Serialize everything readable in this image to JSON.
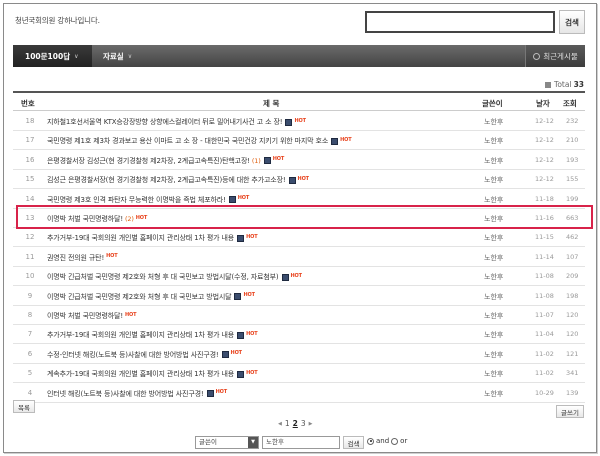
{
  "header": {
    "greeting": "청년국회의원 강하나입니다.",
    "search_button": "검색",
    "search_value": ""
  },
  "nav": {
    "tab1": "100문100답",
    "tab2": "자료실",
    "recent": "최근게시물"
  },
  "list": {
    "total_label": "Total",
    "total_count": "33",
    "columns": {
      "no": "번호",
      "title": "제 목",
      "author": "글쓴이",
      "date": "날자",
      "views": "조회"
    },
    "rows": [
      {
        "no": "18",
        "title": "지하철1호선서울역 KTX승강장방향 상향에스컬레이터 뒤로 밀어내기사건 고 소 장!",
        "comments": "",
        "file": true,
        "hot": true,
        "author": "노한후",
        "date": "12-12",
        "views": "232"
      },
      {
        "no": "17",
        "title": "국민명령 제1호 제3차 경과보고 용산 이마트 고 소 장 - 대한민국 국민건강 지키기 위한 마지막 호소",
        "comments": "",
        "file": true,
        "hot": true,
        "author": "노한후",
        "date": "12-12",
        "views": "210"
      },
      {
        "no": "16",
        "title": "은평경찰서장 김성근(현 경기경찰청 제2차장, 2계급고속특진)탄핵고장!",
        "comments": "(1)",
        "file": true,
        "hot": true,
        "author": "노한후",
        "date": "12-12",
        "views": "193"
      },
      {
        "no": "15",
        "title": "김성근 은평경찰서장(현 경기경찰청 제2차장, 2계급고속특진)등에 대한 추가고소장!",
        "comments": "",
        "file": true,
        "hot": true,
        "author": "노한후",
        "date": "12-12",
        "views": "155"
      },
      {
        "no": "14",
        "title": "국민명령 제3호 인격 파탄자 무능력한 이명박을 즉법 체포하라!",
        "comments": "",
        "file": true,
        "hot": true,
        "author": "노한후",
        "date": "11-18",
        "views": "199"
      },
      {
        "no": "13",
        "title": "이명박 처벌 국민명령하달!",
        "comments": "(2)",
        "file": false,
        "hot": true,
        "author": "노한후",
        "date": "11-16",
        "views": "663"
      },
      {
        "no": "12",
        "title": "추가거부-19대 국회의원 개인별 홈페이지 관리상태 1차 평가 내용",
        "comments": "",
        "file": true,
        "hot": true,
        "author": "노한후",
        "date": "11-15",
        "views": "462"
      },
      {
        "no": "11",
        "title": "권영진 전의원 규탄!",
        "comments": "",
        "file": false,
        "hot": true,
        "author": "노한후",
        "date": "11-14",
        "views": "107"
      },
      {
        "no": "10",
        "title": "이명박 긴급처벌 국민명령 제2호와 처형 후 대 국민보고 방법시달(수정, 자료첨부)",
        "comments": "",
        "file": true,
        "hot": true,
        "author": "노한후",
        "date": "11-08",
        "views": "209"
      },
      {
        "no": "9",
        "title": "이명박 긴급처벌 국민명령 제2호와 처형 후 대 국민보고 방법시달",
        "comments": "",
        "file": true,
        "hot": true,
        "author": "노한후",
        "date": "11-08",
        "views": "198"
      },
      {
        "no": "8",
        "title": "이명박 처벌 국민명령하달!",
        "comments": "",
        "file": false,
        "hot": true,
        "author": "노한후",
        "date": "11-07",
        "views": "120"
      },
      {
        "no": "7",
        "title": "추가거부-19대 국회의원 개인별 홈페이지 관리상태 1차 평가 내용",
        "comments": "",
        "file": true,
        "hot": true,
        "author": "노한후",
        "date": "11-04",
        "views": "120"
      },
      {
        "no": "6",
        "title": "수정-인터넷 해킹(노트북 등)사찰에 대한 방어방법 사진구경!",
        "comments": "",
        "file": true,
        "hot": true,
        "author": "노한후",
        "date": "11-02",
        "views": "121"
      },
      {
        "no": "5",
        "title": "계속추가-19대 국회의원 개인별 홈페이지 관리상태 1차 평가 내용",
        "comments": "",
        "file": true,
        "hot": true,
        "author": "노한후",
        "date": "11-02",
        "views": "341"
      },
      {
        "no": "4",
        "title": "인터넷 해킹(노트북 등)사찰에 대한 방어방법 사진구경!",
        "comments": "",
        "file": true,
        "hot": true,
        "author": "노한후",
        "date": "10-29",
        "views": "139"
      }
    ]
  },
  "buttons": {
    "list": "목록",
    "write": "글쓰기"
  },
  "pager": {
    "pages": [
      "1",
      "2",
      "3"
    ],
    "current": "2"
  },
  "search_form": {
    "field_select": "글쓴이",
    "keyword": "노한후",
    "go": "검색",
    "and_label": "and",
    "or_label": "or"
  },
  "icons": {
    "file": "attachment-icon",
    "hot": "hot-badge-icon"
  },
  "colors": {
    "highlight": "#d8234a",
    "nav_bg": "#444444",
    "hot": "#e8421c"
  }
}
